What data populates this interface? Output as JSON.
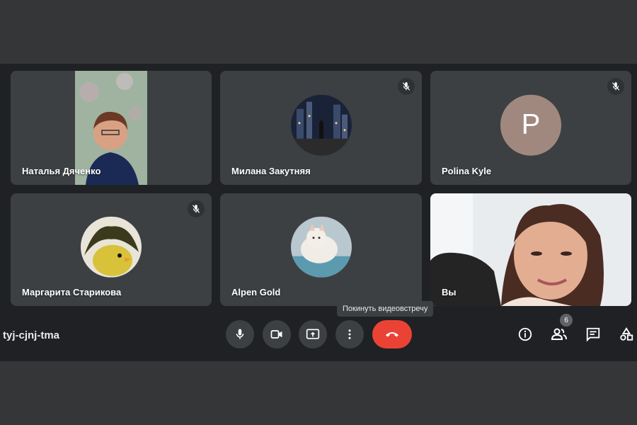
{
  "participants": [
    {
      "name": "Наталья Дяченко",
      "camera": "on",
      "muted": false
    },
    {
      "name": "Милана Закутняя",
      "camera": "off",
      "muted": true
    },
    {
      "name": "Polina Kyle",
      "camera": "off",
      "muted": true,
      "initial": "P"
    },
    {
      "name": "Маргарита Старикова",
      "camera": "off",
      "muted": true
    },
    {
      "name": "Alpen Gold",
      "camera": "off",
      "muted": false
    },
    {
      "name": "Вы",
      "camera": "on",
      "muted": false
    }
  ],
  "tooltip": "Покинуть видеовстречу",
  "meeting_code": "tyj-cjnj-tma",
  "controls": {
    "mic": "mic-icon",
    "camera": "video-camera-icon",
    "present": "present-screen-icon",
    "more": "more-vert-icon",
    "end": "end-call-icon"
  },
  "right_controls": {
    "info": "info-icon",
    "people": "people-icon",
    "people_count": "6",
    "chat": "chat-icon",
    "activities": "activities-icon"
  },
  "colors": {
    "end_call": "#ea4335",
    "tile_bg": "#3c4043",
    "app_bg": "#202124",
    "outer_bg": "#343638"
  }
}
